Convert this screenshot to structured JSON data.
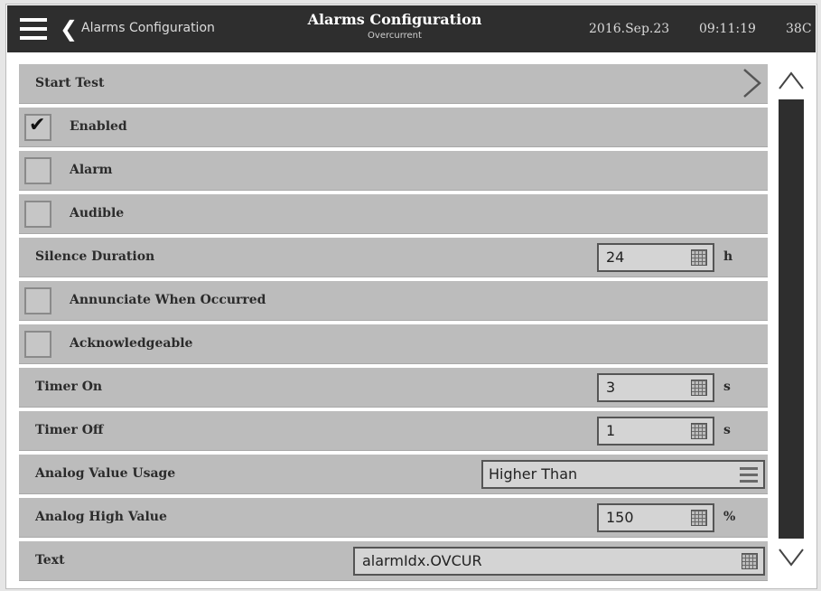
{
  "header": {
    "menu_icon": "hamburger-menu-icon",
    "back_icon": "chevron-left-icon",
    "back_label": "Alarms Configuration",
    "title": "Alarms Configuration",
    "subtitle": "Overcurrent",
    "date": "2016.Sep.23",
    "time": "09:11:19",
    "temperature": "38C"
  },
  "rows": {
    "start_test": {
      "label": "Start Test",
      "icon": "chevron-right-icon"
    },
    "enabled": {
      "label": "Enabled",
      "checked": true
    },
    "alarm": {
      "label": "Alarm",
      "checked": false
    },
    "audible": {
      "label": "Audible",
      "checked": false
    },
    "silence_duration": {
      "label": "Silence Duration",
      "value": "24",
      "unit": "h"
    },
    "annunciate": {
      "label": "Annunciate When Occurred",
      "checked": false
    },
    "acknowledgeable": {
      "label": "Acknowledgeable",
      "checked": false
    },
    "timer_on": {
      "label": "Timer On",
      "value": "3",
      "unit": "s"
    },
    "timer_off": {
      "label": "Timer Off",
      "value": "1",
      "unit": "s"
    },
    "analog_usage": {
      "label": "Analog Value Usage",
      "value": "Higher Than"
    },
    "analog_high": {
      "label": "Analog High Value",
      "value": "150",
      "unit": "%"
    },
    "text": {
      "label": "Text",
      "value": "alarmIdx.OVCUR"
    }
  },
  "scrollbar": {
    "up_icon": "chevron-up-icon",
    "down_icon": "chevron-down-icon"
  },
  "colors": {
    "header_bg": "#2e2e2e",
    "row_bg": "#bcbcbc",
    "field_bg": "#d4d4d4",
    "scroll_track": "#2e2e2e"
  }
}
